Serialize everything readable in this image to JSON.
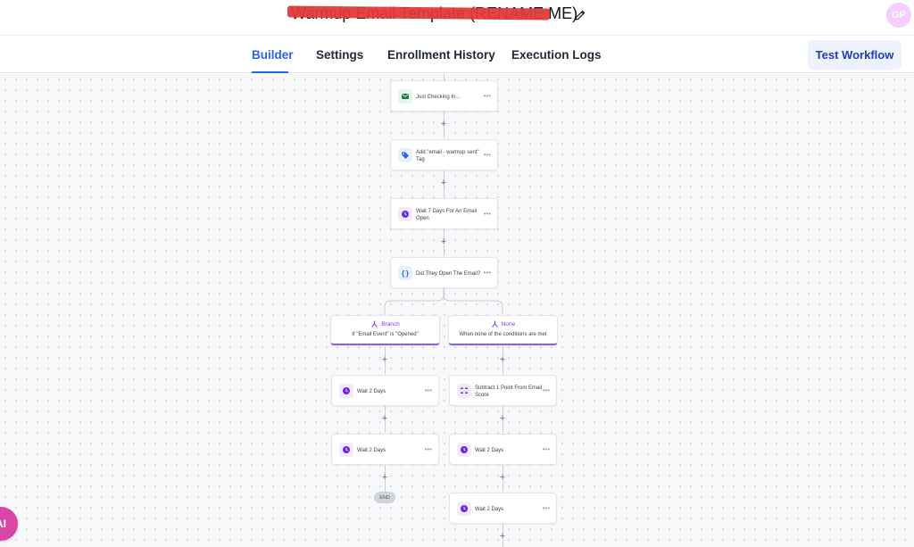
{
  "header": {
    "workflow_title": "Warmup Email Template (RENAME ME)",
    "user_initials": "GP"
  },
  "tabs": [
    {
      "label": "Builder",
      "active": true
    },
    {
      "label": "Settings",
      "active": false
    },
    {
      "label": "Enrollment History",
      "active": false
    },
    {
      "label": "Execution Logs",
      "active": false
    }
  ],
  "actions": {
    "test_workflow_label": "Test Workflow"
  },
  "nodes": {
    "email": {
      "label": "Just Checking In...",
      "icon": "email-icon"
    },
    "add_tag": {
      "label": "Add \"email - warmup sent\" Tag",
      "icon": "tag-icon"
    },
    "wait_open": {
      "label": "Wait 7 Days For An Email Open",
      "icon": "clock-icon"
    },
    "condition": {
      "label": "Did They Open The Email?",
      "icon": "code-braces-icon"
    },
    "left_wait_1": {
      "label": "Wait 2 Days",
      "icon": "clock-icon"
    },
    "left_wait_2": {
      "label": "Wait 2 Days",
      "icon": "clock-icon"
    },
    "right_score": {
      "label": "Subtract 1 Point From Email Score",
      "icon": "score-icon"
    },
    "right_wait_1": {
      "label": "Wait 2 Days",
      "icon": "clock-icon"
    },
    "right_wait_2": {
      "label": "Wait 2 Days",
      "icon": "clock-icon"
    }
  },
  "branches": {
    "left": {
      "title": "Branch",
      "subtitle": "If \"Email Event\" is \"Opened\""
    },
    "right": {
      "title": "None",
      "subtitle": "When none of the conditions are met"
    }
  },
  "end_label": "END",
  "ai_button_label": "AI",
  "colors": {
    "accent": "#2563eb",
    "branch_purple": "#8b5cf6",
    "email_green": "#15803d",
    "tag_blue": "#2563eb",
    "wait_purple": "#6d28d9",
    "redaction_red": "#e23b3b",
    "ai_pink": "#d946a8"
  }
}
